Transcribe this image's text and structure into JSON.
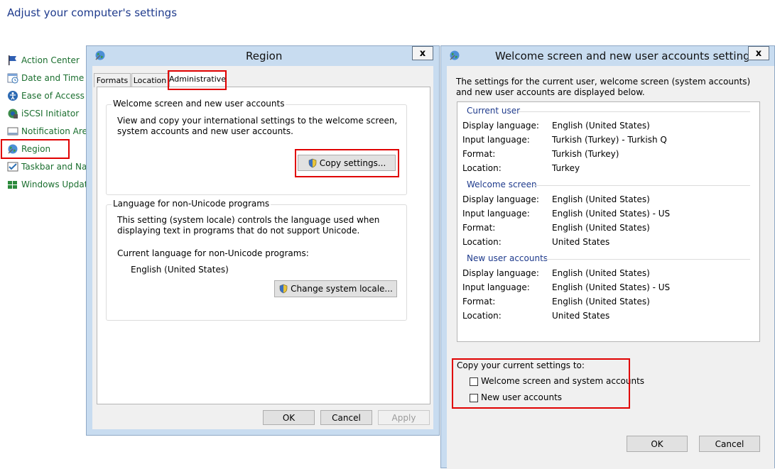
{
  "page": {
    "title": "Adjust your computer's settings"
  },
  "sidebar": {
    "items": [
      {
        "label": "Action Center",
        "icon": "flag-icon"
      },
      {
        "label": "Date and Time",
        "icon": "clock-icon"
      },
      {
        "label": "Ease of Access Ce",
        "icon": "ease-of-access-icon"
      },
      {
        "label": "iSCSI Initiator",
        "icon": "iscsi-icon"
      },
      {
        "label": "Notification Area",
        "icon": "notification-area-icon"
      },
      {
        "label": "Region",
        "icon": "globe-icon"
      },
      {
        "label": "Taskbar and Navi",
        "icon": "taskbar-icon"
      },
      {
        "label": "Windows Update",
        "icon": "windows-update-icon"
      }
    ]
  },
  "region_dialog": {
    "title": "Region",
    "close": "x",
    "tabs": [
      "Formats",
      "Location",
      "Administrative"
    ],
    "active_tab": "Administrative",
    "welcome_group": {
      "label": "Welcome screen and new user accounts",
      "description": "View and copy your international settings to the welcome screen, system accounts and new user accounts.",
      "button": "Copy settings..."
    },
    "unicode_group": {
      "label": "Language for non-Unicode programs",
      "description": "This setting (system locale) controls the language used when displaying text in programs that do not support Unicode.",
      "current_label": "Current language for non-Unicode programs:",
      "current_value": "English (United States)",
      "button": "Change system locale..."
    },
    "buttons": {
      "ok": "OK",
      "cancel": "Cancel",
      "apply": "Apply"
    }
  },
  "welcome_dialog": {
    "title": "Welcome screen and new user accounts settings",
    "close": "x",
    "intro": "The settings for the current user, welcome screen (system accounts) and new user accounts are displayed below.",
    "sections": [
      {
        "title": "Current user",
        "rows": [
          {
            "label": "Display language:",
            "value": "English (United States)"
          },
          {
            "label": "Input language:",
            "value": "Turkish (Turkey) - Turkish Q"
          },
          {
            "label": "Format:",
            "value": "Turkish (Turkey)"
          },
          {
            "label": "Location:",
            "value": "Turkey"
          }
        ]
      },
      {
        "title": "Welcome screen",
        "rows": [
          {
            "label": "Display language:",
            "value": "English (United States)"
          },
          {
            "label": "Input language:",
            "value": "English (United States) - US"
          },
          {
            "label": "Format:",
            "value": "English (United States)"
          },
          {
            "label": "Location:",
            "value": "United States"
          }
        ]
      },
      {
        "title": "New user accounts",
        "rows": [
          {
            "label": "Display language:",
            "value": "English (United States)"
          },
          {
            "label": "Input language:",
            "value": "English (United States) - US"
          },
          {
            "label": "Format:",
            "value": "English (United States)"
          },
          {
            "label": "Location:",
            "value": "United States"
          }
        ]
      }
    ],
    "copy_label": "Copy your current settings to:",
    "checkboxes": [
      {
        "label": "Welcome screen and system accounts",
        "checked": false
      },
      {
        "label": "New user accounts",
        "checked": false
      }
    ],
    "buttons": {
      "ok": "OK",
      "cancel": "Cancel"
    }
  },
  "colors": {
    "highlight": "#e00000",
    "link": "#1e3a8c",
    "cp_item": "#1a6e2e",
    "title_bar": "#c8dcf0"
  }
}
